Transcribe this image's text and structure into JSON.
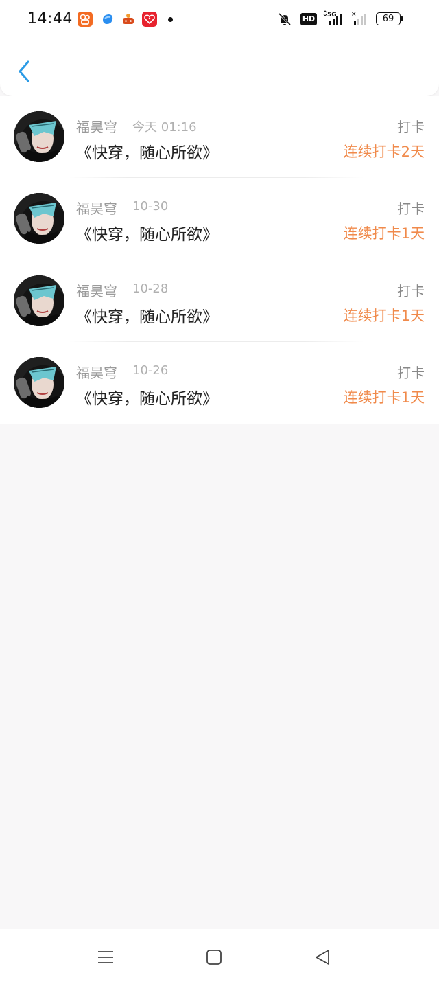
{
  "status_bar": {
    "time": "14:44",
    "battery": "69",
    "network": "5G",
    "hd_badge": "HD",
    "icons": [
      "kuaishou-app-icon",
      "blue-app-icon",
      "game-app-icon",
      "red-heart-app-icon",
      "notification-dot",
      "mute-icon",
      "hd-icon",
      "signal-5g-icon",
      "signal-weak-icon",
      "battery-icon"
    ]
  },
  "nav": {
    "back_icon": "chevron-left-icon",
    "back_color": "#2b9be6"
  },
  "checkins": [
    {
      "user": "福昊穹",
      "time": "今天 01:16",
      "book": "《快穿，随心所欲》",
      "label": "打卡",
      "streak": "连续打卡2天"
    },
    {
      "user": "福昊穹",
      "time": "10-30",
      "book": "《快穿，随心所欲》",
      "label": "打卡",
      "streak": "连续打卡1天"
    },
    {
      "user": "福昊穹",
      "time": "10-28",
      "book": "《快穿，随心所欲》",
      "label": "打卡",
      "streak": "连续打卡1天"
    },
    {
      "user": "福昊穹",
      "time": "10-26",
      "book": "《快穿，随心所欲》",
      "label": "打卡",
      "streak": "连续打卡1天"
    }
  ],
  "colors": {
    "accent_orange": "#f08a4b",
    "muted_text": "#9a9a9a",
    "title_text": "#222222",
    "background": "#f8f7f8"
  },
  "system_nav": {
    "icons": [
      "menu-icon",
      "home-icon",
      "back-triangle-icon"
    ]
  }
}
